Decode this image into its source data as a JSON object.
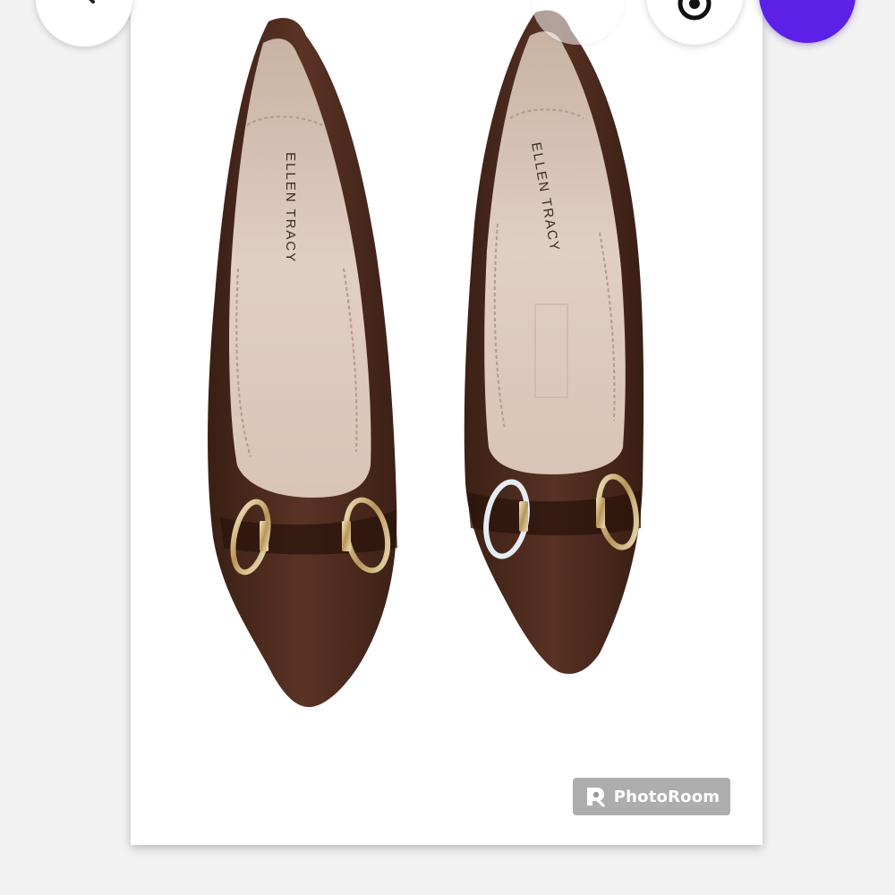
{
  "product_image": {
    "brand_text": "ELLEN TRACY",
    "subject": "brown suede pointed-toe pumps with gold horsebit ring hardware"
  },
  "watermark": {
    "label": "PhotoRoom",
    "icon": "photoroom-logo-icon"
  },
  "top_buttons": {
    "back_icon": "back-arrow-icon",
    "lens_icon": "lens-search-icon",
    "add_icon": "add-photo-icon",
    "add_color": "#5b21e6"
  }
}
